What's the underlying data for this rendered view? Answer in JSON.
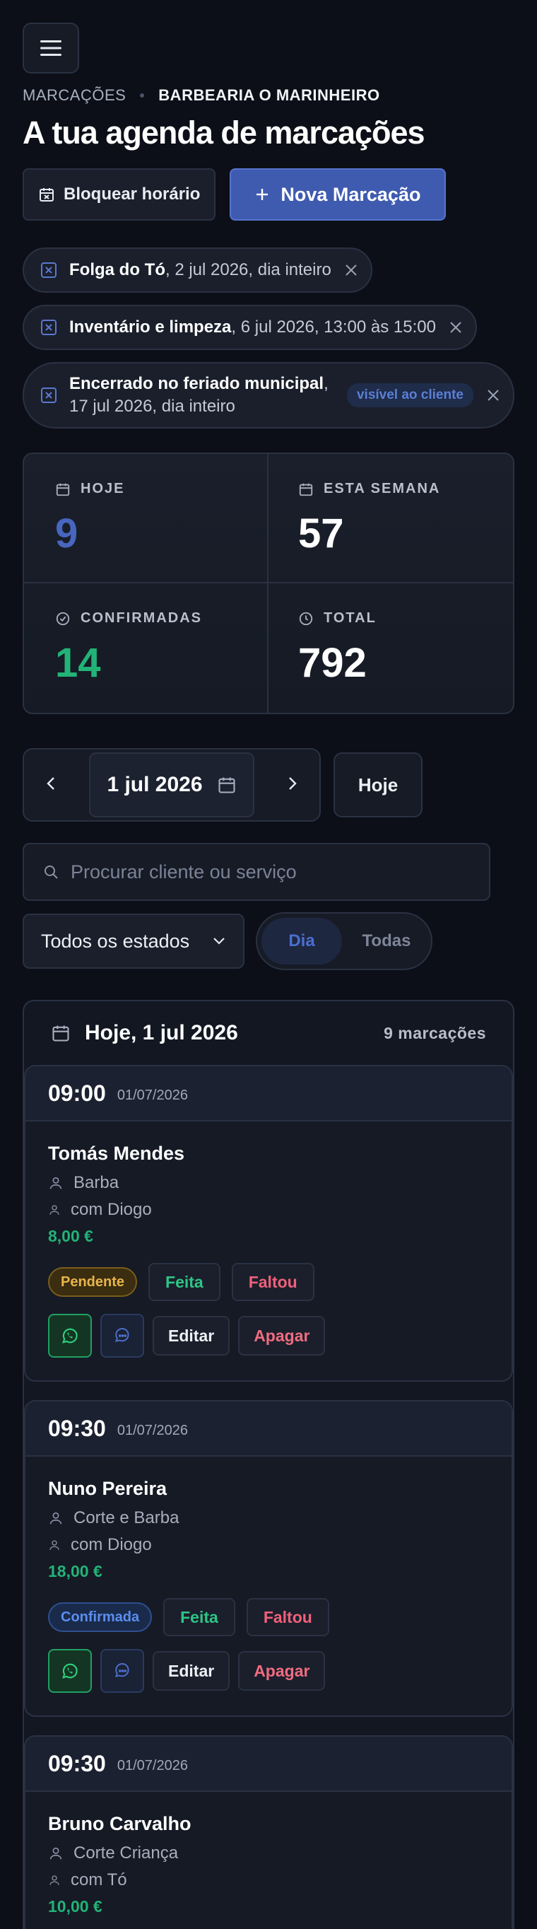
{
  "header": {
    "menu_icon": "hamburger-menu-icon",
    "breadcrumb_section": "MARCAÇÕES",
    "breadcrumb_shop": "BARBEARIA O MARINHEIRO",
    "title": "A tua agenda de marcações"
  },
  "actions": {
    "block_label": "Bloquear horário",
    "new_label": "Nova Marcação"
  },
  "blocks": [
    {
      "title": "Folga do Tó",
      "detail": ", 2 jul 2026, dia inteiro"
    },
    {
      "title": "Inventário e limpeza",
      "detail": ", 6 jul 2026, 13:00 às 15:00"
    },
    {
      "title": "Encerrado no feriado municipal",
      "detail_line1": ",",
      "detail_line2": "17 jul 2026, dia inteiro",
      "badge": "visível ao cliente"
    }
  ],
  "stats": {
    "today_label": "HOJE",
    "today_value": "9",
    "week_label": "ESTA SEMANA",
    "week_value": "57",
    "confirmed_label": "CONFIRMADAS",
    "confirmed_value": "14",
    "total_label": "TOTAL",
    "total_value": "792"
  },
  "date_nav": {
    "current_date": "1 jul 2026",
    "today_label": "Hoje"
  },
  "search": {
    "placeholder": "Procurar cliente ou serviço"
  },
  "filters": {
    "status_selected": "Todos os estados",
    "seg_day": "Dia",
    "seg_all": "Todas"
  },
  "list": {
    "heading": "Hoje, 1 jul 2026",
    "count": "9 marcações"
  },
  "appointments": [
    {
      "time": "09:00",
      "date": "01/07/2026",
      "client": "Tomás Mendes",
      "service": "Barba",
      "barber": "com Diogo",
      "price": "8,00 €",
      "status": "Pendente",
      "done_label": "Feita",
      "missed_label": "Faltou",
      "edit_label": "Editar",
      "delete_label": "Apagar"
    },
    {
      "time": "09:30",
      "date": "01/07/2026",
      "client": "Nuno Pereira",
      "service": "Corte e Barba",
      "barber": "com Diogo",
      "price": "18,00 €",
      "status": "Confirmada",
      "done_label": "Feita",
      "missed_label": "Faltou",
      "edit_label": "Editar",
      "delete_label": "Apagar"
    },
    {
      "time": "09:30",
      "date": "01/07/2026",
      "client": "Bruno Carvalho",
      "service": "Corte Criança",
      "barber": "com Tó",
      "price": "10,00 €"
    }
  ],
  "colors": {
    "background": "#0c0f17",
    "accent": "#3f5bb0",
    "green": "#22b377",
    "danger": "#f06c80",
    "pending": "#e8b54a"
  }
}
